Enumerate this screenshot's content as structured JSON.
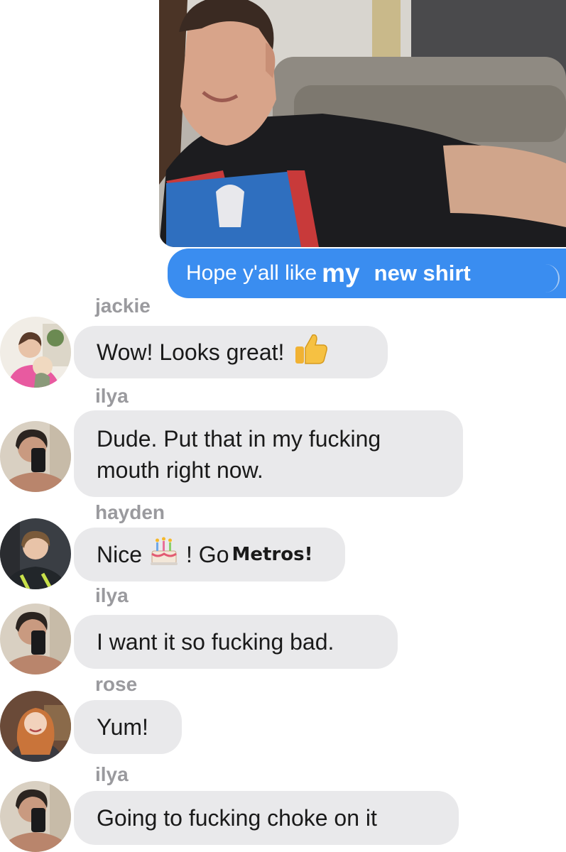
{
  "outgoing": {
    "part1": "Hope y'all like",
    "part2": "my",
    "part3": "new shirt",
    "color": "#3a8df0"
  },
  "messages": [
    {
      "sender": "jackie",
      "text": "Wow! Looks great!",
      "emoji": "thumbs-up"
    },
    {
      "sender": "ilya",
      "line1": "Dude. Put that in my fucking",
      "line2": "mouth right now."
    },
    {
      "sender": "hayden",
      "text_before": "Nice",
      "emoji": "birthday-cake",
      "text_after": "! Go",
      "bold": "Metros!"
    },
    {
      "sender": "ilya",
      "text": "I want it so fucking bad."
    },
    {
      "sender": "rose",
      "text": "Yum!"
    },
    {
      "sender": "ilya",
      "text": "Going to fucking choke on it"
    }
  ],
  "colors": {
    "incoming_bubble": "#e9e9eb",
    "sender_name": "#9a9a9e"
  }
}
